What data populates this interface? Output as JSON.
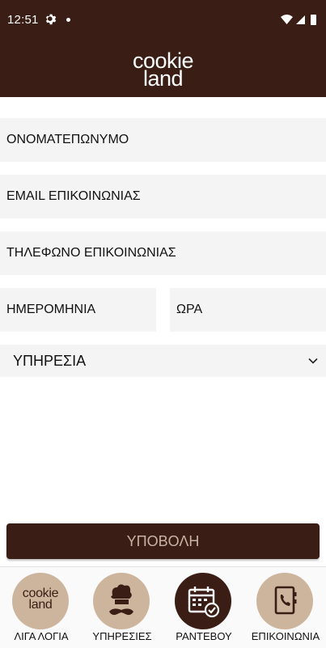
{
  "status_bar": {
    "time": "12:51"
  },
  "brand": {
    "line1": "cookie",
    "line2": "land"
  },
  "form": {
    "name_placeholder": "ΟΝΟΜΑΤΕΠΩΝΥΜΟ",
    "email_placeholder": "EMAIL ΕΠΙΚΟΙΝΩΝΙΑΣ",
    "phone_placeholder": "ΤΗΛΕΦΩΝΟ ΕΠΙΚΟΙΝΩΝΙΑΣ",
    "date_placeholder": "ΗΜΕΡΟΜΗΝΙΑ",
    "time_placeholder": "ΩΡΑ",
    "service_selected": "ΥΠΗΡΕΣΙΑ",
    "submit_label": "ΥΠΟΒΟΛΗ"
  },
  "bottom_nav": {
    "items": [
      {
        "label": "ΛΙΓΑ ΛΟΓΙΑ",
        "icon": "cookieland-logo-icon",
        "active": false
      },
      {
        "label": "ΥΠΗΡΕΣΙΕΣ",
        "icon": "chef-mustache-icon",
        "active": false
      },
      {
        "label": "ΡΑΝΤΕΒΟΥ",
        "icon": "calendar-check-icon",
        "active": true
      },
      {
        "label": "ΕΠΙΚΟΙΝΩΝΙΑ",
        "icon": "phone-book-icon",
        "active": false
      }
    ]
  },
  "colors": {
    "brand_brown": "#3a1d14",
    "badge_tan": "#cdb59d",
    "field_bg": "#f4f4f4"
  }
}
